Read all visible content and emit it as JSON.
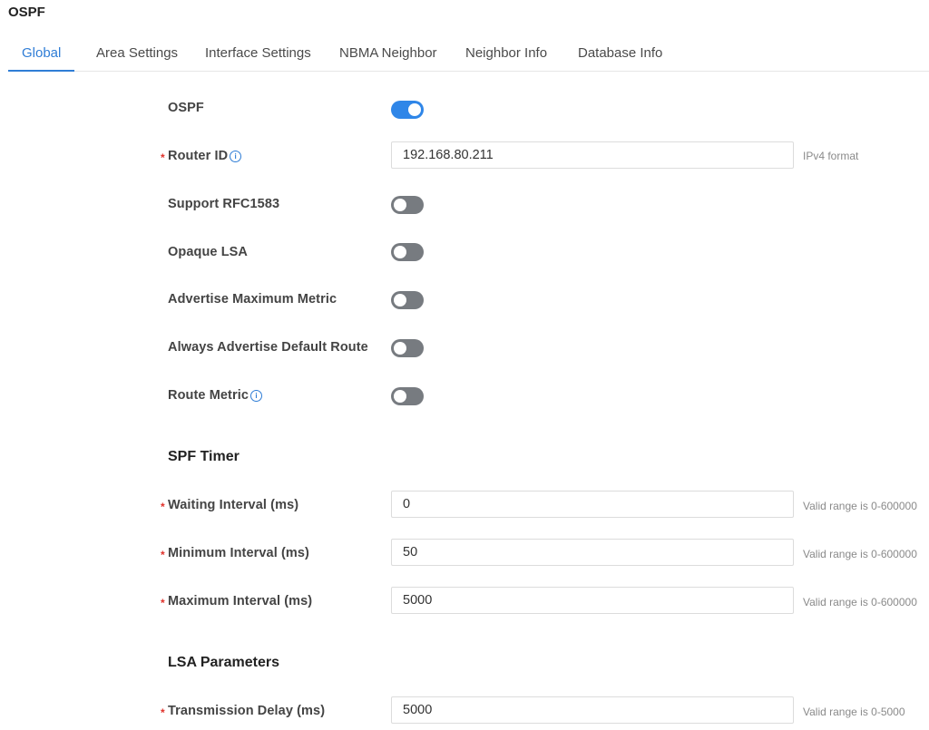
{
  "page_title": "OSPF",
  "tabs": [
    {
      "label": "Global",
      "active": true
    },
    {
      "label": "Area Settings"
    },
    {
      "label": "Interface Settings"
    },
    {
      "label": "NBMA Neighbor"
    },
    {
      "label": "Neighbor Info"
    },
    {
      "label": "Database Info"
    }
  ],
  "colors": {
    "accent": "#2f7dd6",
    "toggle_on": "#2f86e8",
    "toggle_off": "#777b80",
    "required": "#e0322b"
  },
  "global": {
    "ospf": {
      "label": "OSPF",
      "enabled": true
    },
    "router_id": {
      "label": "Router ID",
      "value": "192.168.80.211",
      "hint": "IPv4 format",
      "required": true
    },
    "support_rfc1583": {
      "label": "Support RFC1583",
      "enabled": false
    },
    "opaque_lsa": {
      "label": "Opaque LSA",
      "enabled": false
    },
    "advertise_max_metric": {
      "label": "Advertise Maximum Metric",
      "enabled": false
    },
    "always_advertise_default": {
      "label": "Always Advertise Default Route",
      "enabled": false
    },
    "route_metric": {
      "label": "Route Metric",
      "enabled": false
    }
  },
  "spf_timer": {
    "title": "SPF Timer",
    "waiting_interval": {
      "label": "Waiting Interval (ms)",
      "value": "0",
      "hint": "Valid range is 0-600000"
    },
    "minimum_interval": {
      "label": "Minimum Interval (ms)",
      "value": "50",
      "hint": "Valid range is 0-600000"
    },
    "maximum_interval": {
      "label": "Maximum Interval (ms)",
      "value": "5000",
      "hint": "Valid range is 0-600000"
    }
  },
  "lsa_parameters": {
    "title": "LSA Parameters",
    "transmission_delay": {
      "label": "Transmission Delay (ms)",
      "value": "5000",
      "hint": "Valid range is 0-5000"
    }
  }
}
